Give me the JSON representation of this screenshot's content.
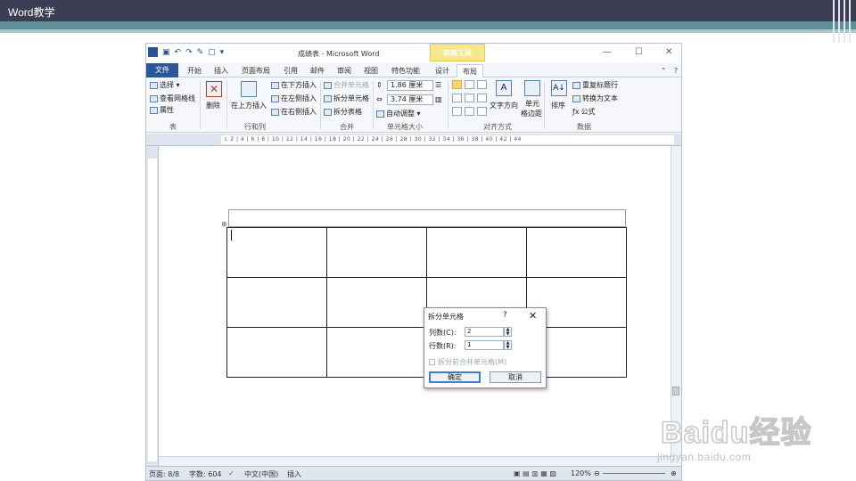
{
  "slide": {
    "title": "Word教学"
  },
  "app": {
    "window_title": "成绩表 - Microsoft Word",
    "context_tab": "表格工具",
    "tabs": [
      "文件",
      "开始",
      "插入",
      "页面布局",
      "引用",
      "邮件",
      "审阅",
      "视图",
      "特色功能",
      "设计",
      "布局"
    ],
    "active_tab": "布局",
    "ribbon": {
      "table_group": {
        "select": "选择 ▾",
        "gridlines": "查看网格线",
        "properties": "属性",
        "label": "表"
      },
      "delete": {
        "label": "删除"
      },
      "rows_cols": {
        "insert_above": "在上方插入",
        "insert_below": "在下方插入",
        "insert_left": "在左侧插入",
        "insert_right": "在右侧插入",
        "label": "行和列"
      },
      "merge": {
        "merge_cells": "合并单元格",
        "split_cells": "拆分单元格",
        "split_table": "拆分表格",
        "label": "合并"
      },
      "cell_size": {
        "height": "1.86 厘米",
        "width": "3.74 厘米",
        "autofit": "自动调整 ▾",
        "label": "单元格大小"
      },
      "alignment": {
        "text_direction": "文字方向",
        "cell_margins_1": "单元",
        "cell_margins_2": "格边距",
        "label": "对齐方式"
      },
      "data": {
        "sort": "排序",
        "repeat_header": "重复标题行",
        "convert_text": "转换为文本",
        "formula": "公式",
        "label": "数据"
      }
    },
    "ruler_text": "L 2 | 4 | 6 | 8 | 10 | 12 | 14 | 16 | 18 | 20 | 22 | 24 | 26 | 28 | 30 | 32 | 34 | 36 | 38 | 40 | 42 | 44",
    "status": {
      "page": "页面: 8/8",
      "words": "字数: 604",
      "lang": "中文(中国)",
      "mode": "插入",
      "zoom": "120%"
    }
  },
  "dialog": {
    "title": "拆分单元格",
    "help": "?",
    "close": "✕",
    "cols_label": "列数(C):",
    "cols_value": "2",
    "rows_label": "行数(R):",
    "rows_value": "1",
    "merge_before": "拆分前合并单元格(M)",
    "ok": "确定",
    "cancel": "取消"
  },
  "watermark": {
    "brand": "Baidu经验",
    "url": "jingyan.baidu.com"
  }
}
